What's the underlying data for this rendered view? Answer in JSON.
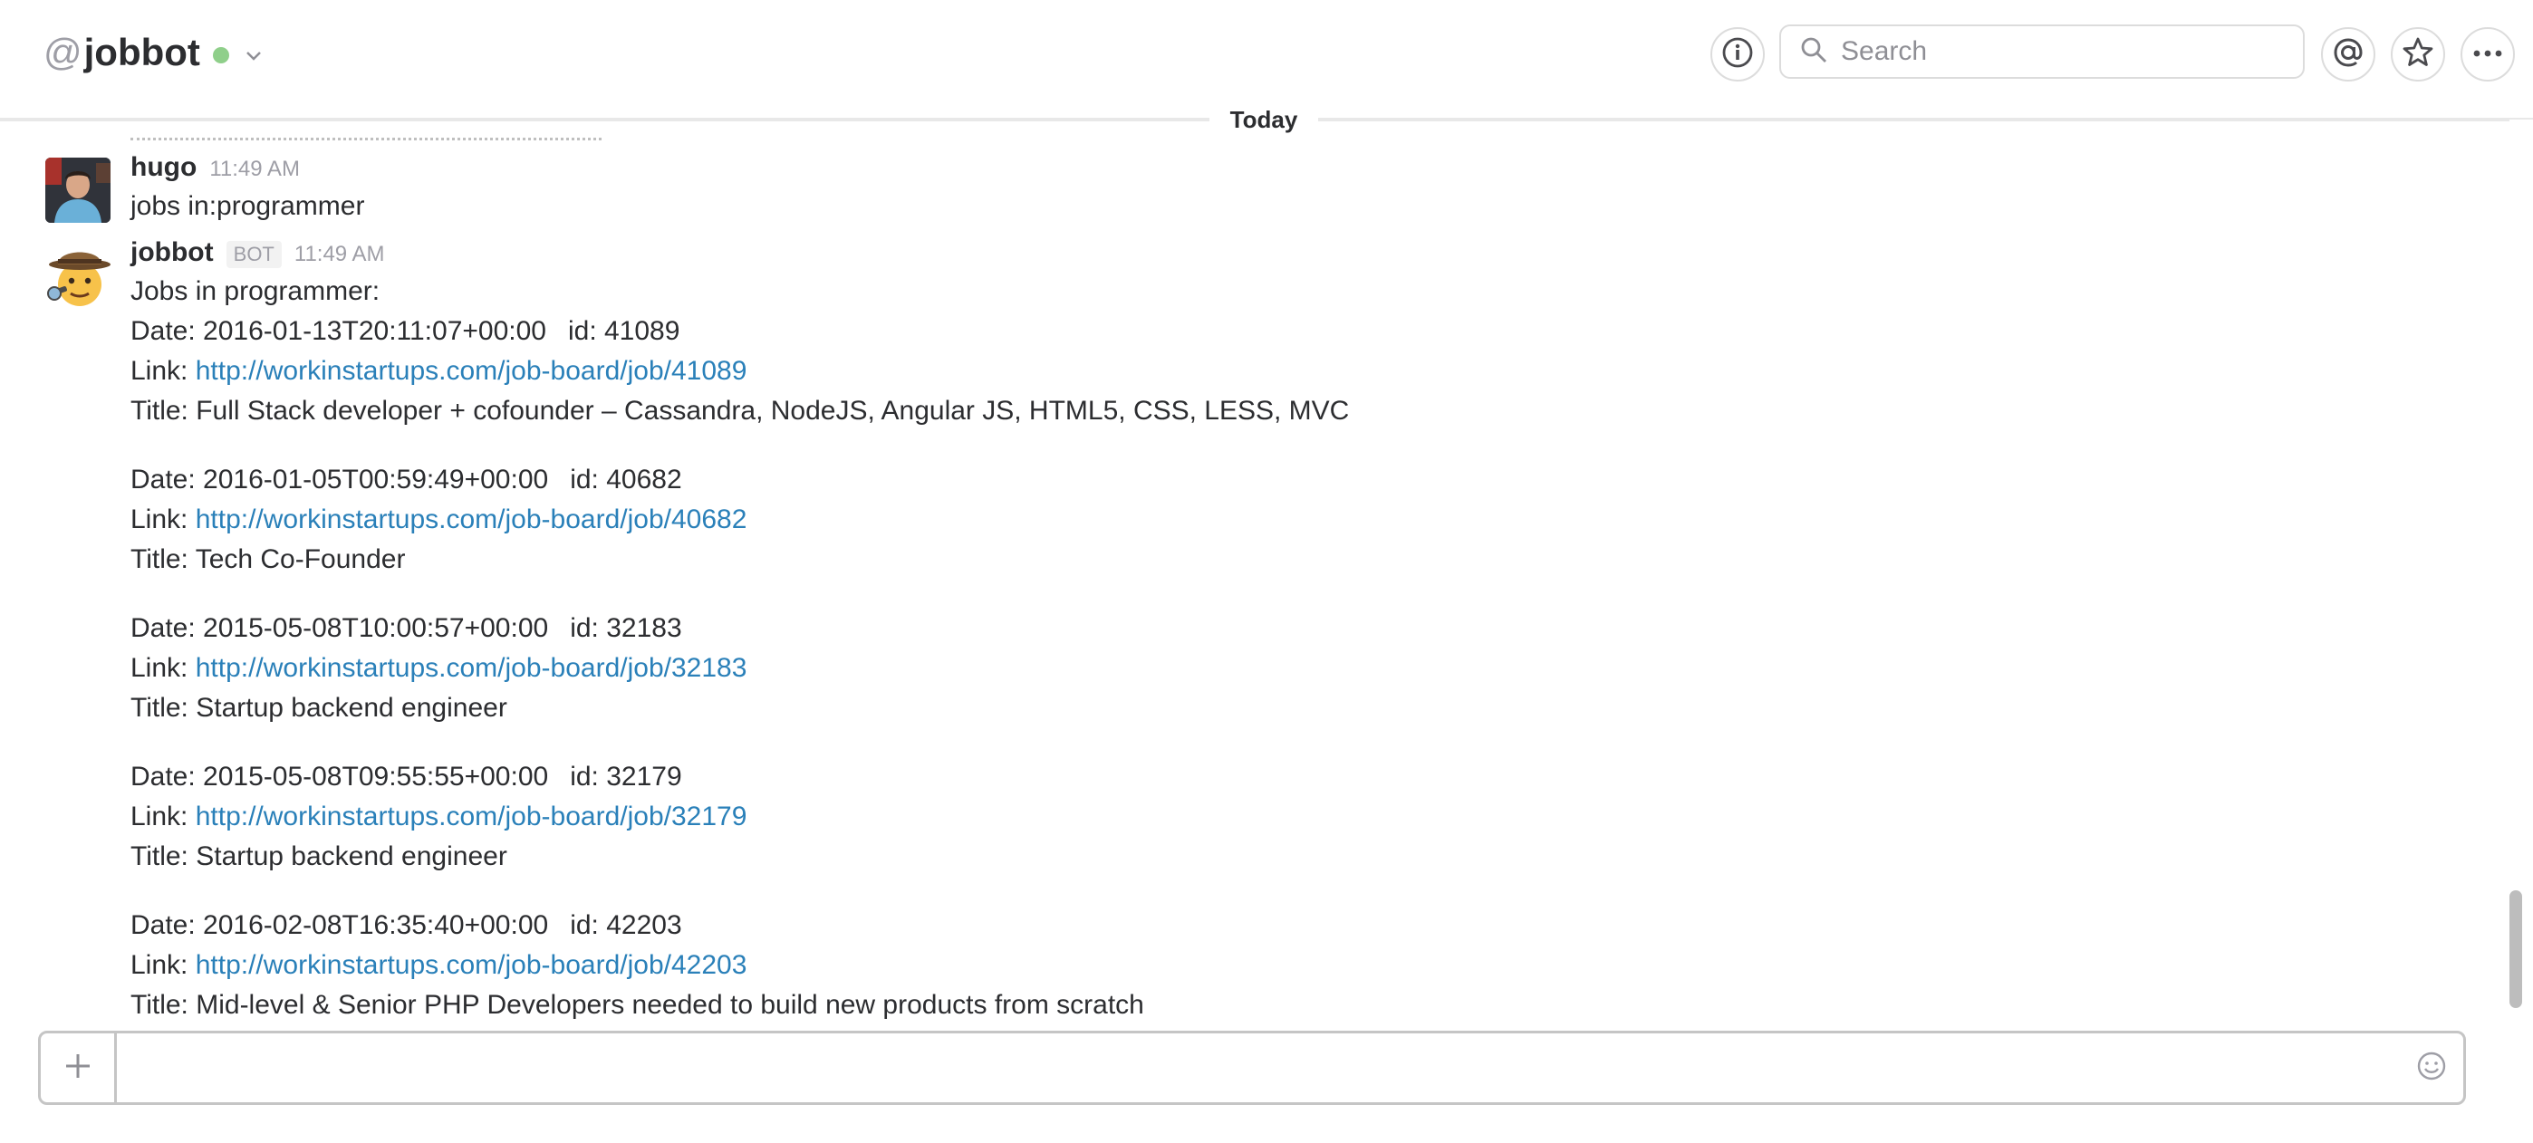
{
  "header": {
    "channel_prefix": "@",
    "channel_name": "jobbot",
    "presence": "online",
    "search_placeholder": "Search"
  },
  "day_divider": "Today",
  "messages": [
    {
      "sender": "hugo",
      "time": "11:49 AM",
      "text": "jobs in:programmer"
    },
    {
      "sender": "jobbot",
      "badge": "BOT",
      "time": "11:49 AM",
      "intro": "Jobs in programmer:",
      "jobs": [
        {
          "date_line": "Date: 2016-01-13T20:11:07+00:00",
          "id_line": "id: 41089",
          "link_label": "Link: ",
          "link": "http://workinstartups.com/job-board/job/41089",
          "title_line": "Title: Full Stack developer + cofounder – Cassandra, NodeJS, Angular JS, HTML5, CSS, LESS, MVC"
        },
        {
          "date_line": "Date: 2016-01-05T00:59:49+00:00",
          "id_line": "id: 40682",
          "link_label": "Link: ",
          "link": "http://workinstartups.com/job-board/job/40682",
          "title_line": "Title: Tech Co-Founder"
        },
        {
          "date_line": "Date: 2015-05-08T10:00:57+00:00",
          "id_line": "id: 32183",
          "link_label": "Link: ",
          "link": "http://workinstartups.com/job-board/job/32183",
          "title_line": "Title: Startup backend engineer"
        },
        {
          "date_line": "Date: 2015-05-08T09:55:55+00:00",
          "id_line": "id: 32179",
          "link_label": "Link: ",
          "link": "http://workinstartups.com/job-board/job/32179",
          "title_line": "Title: Startup backend engineer"
        },
        {
          "date_line": "Date: 2016-02-08T16:35:40+00:00",
          "id_line": "id: 42203",
          "link_label": "Link: ",
          "link": "http://workinstartups.com/job-board/job/42203",
          "title_line": "Title: Mid-level & Senior PHP Developers needed to build new products from scratch"
        }
      ]
    }
  ],
  "composer": {
    "value": ""
  },
  "colors": {
    "link": "#2a80b9",
    "presence": "#8fcf8a",
    "muted": "#9e9ea6"
  }
}
